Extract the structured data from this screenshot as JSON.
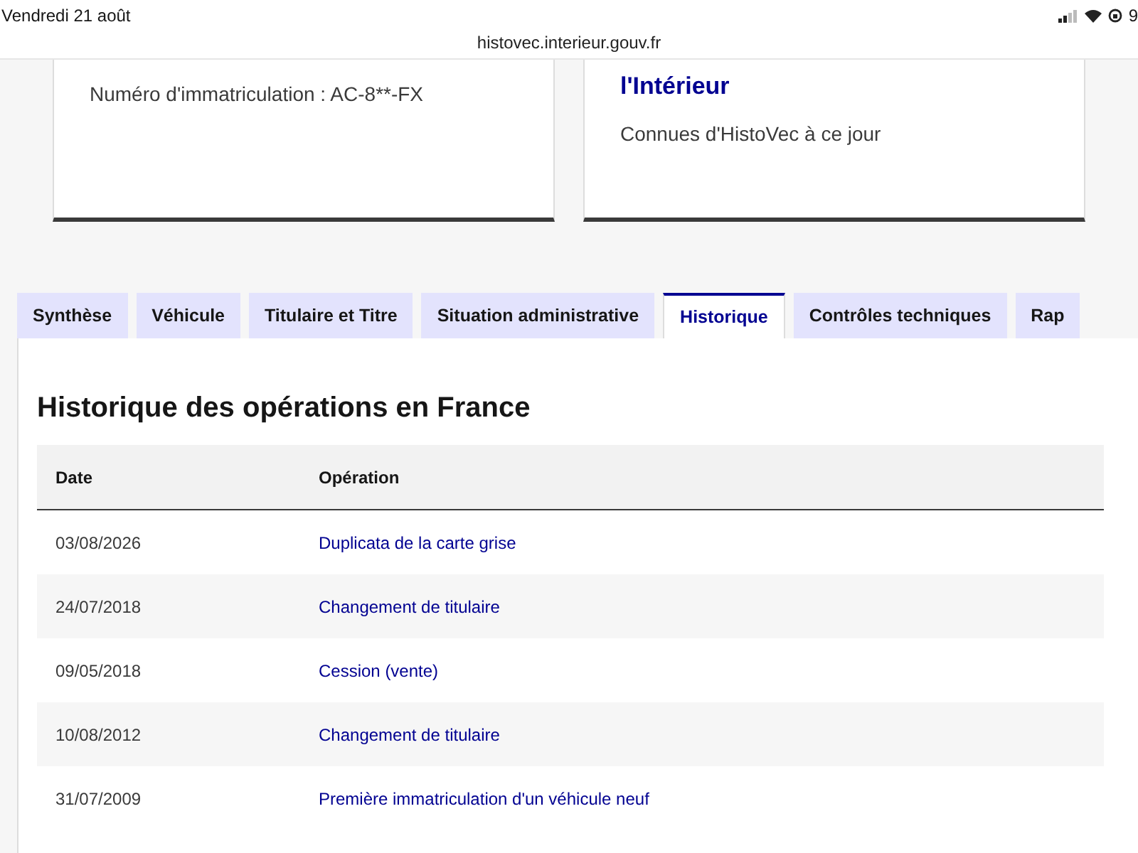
{
  "status_bar": {
    "date": "Vendredi 21 août",
    "time": "9"
  },
  "address_bar": {
    "url": "histovec.interieur.gouv.fr"
  },
  "cards": [
    {
      "text": "Numéro d'immatriculation : AC-8**-FX"
    },
    {
      "title": "l'Intérieur",
      "text": "Connues d'HistoVec à ce jour"
    }
  ],
  "tabs": [
    {
      "label": "Synthèse",
      "selected": false
    },
    {
      "label": "Véhicule",
      "selected": false
    },
    {
      "label": "Titulaire et Titre",
      "selected": false
    },
    {
      "label": "Situation administrative",
      "selected": false
    },
    {
      "label": "Historique",
      "selected": true
    },
    {
      "label": "Contrôles techniques",
      "selected": false
    },
    {
      "label": "Rap",
      "selected": false
    }
  ],
  "section_title": "Historique des opérations en France",
  "table": {
    "columns": [
      "Date",
      "Opération"
    ],
    "rows": [
      {
        "date": "03/08/2026",
        "operation": "Duplicata de la carte grise"
      },
      {
        "date": "24/07/2018",
        "operation": "Changement de titulaire"
      },
      {
        "date": "09/05/2018",
        "operation": "Cession (vente)"
      },
      {
        "date": "10/08/2012",
        "operation": "Changement de titulaire"
      },
      {
        "date": "31/07/2009",
        "operation": "Première immatriculation d'un véhicule neuf"
      }
    ]
  }
}
